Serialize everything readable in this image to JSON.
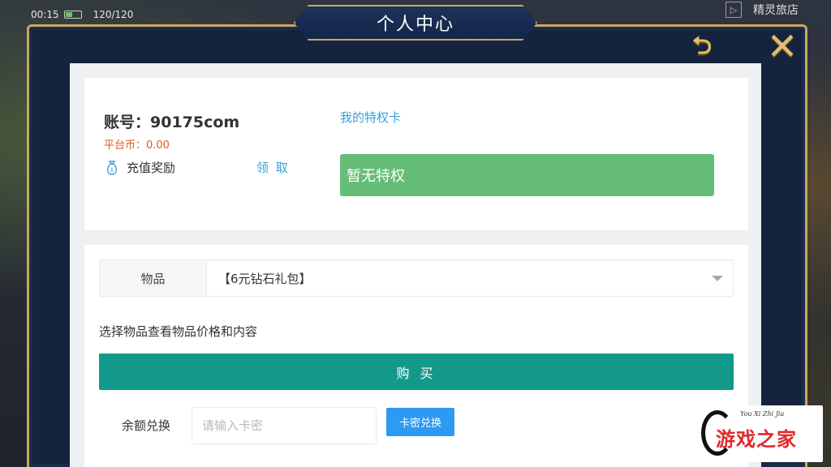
{
  "status_bar": {
    "time": "00:15",
    "energy": "120/120",
    "right_label": "精灵旅店"
  },
  "modal": {
    "title": "个人中心",
    "back_icon": "return-arrow-icon",
    "close_icon": "close-x-icon"
  },
  "account": {
    "label": "账号：90175com",
    "platform_coins": "平台币：0.00",
    "recharge_reward_label": "充值奖励",
    "claim_label": "领 取",
    "privilege_link": "我的特权卡",
    "privilege_status": "暂无特权"
  },
  "shop": {
    "item_label": "物品",
    "item_selected": "【6元钻石礼包】",
    "hint": "选择物品查看物品价格和内容",
    "buy_label": "购 买",
    "redeem_label": "余额兑换",
    "redeem_placeholder": "请输入卡密",
    "redeem_button": "卡密兑换"
  },
  "watermark": {
    "text": "游戏之家",
    "script": "You Xi Zhi Jia"
  },
  "colors": {
    "frame_gold": "#c9a760",
    "frame_navy": "#15233e",
    "privilege_green": "#66bd78",
    "buy_teal": "#13998a",
    "redeem_blue": "#2f9af3",
    "link_blue": "#3aa0d8",
    "coin_orange": "#e05a22"
  }
}
